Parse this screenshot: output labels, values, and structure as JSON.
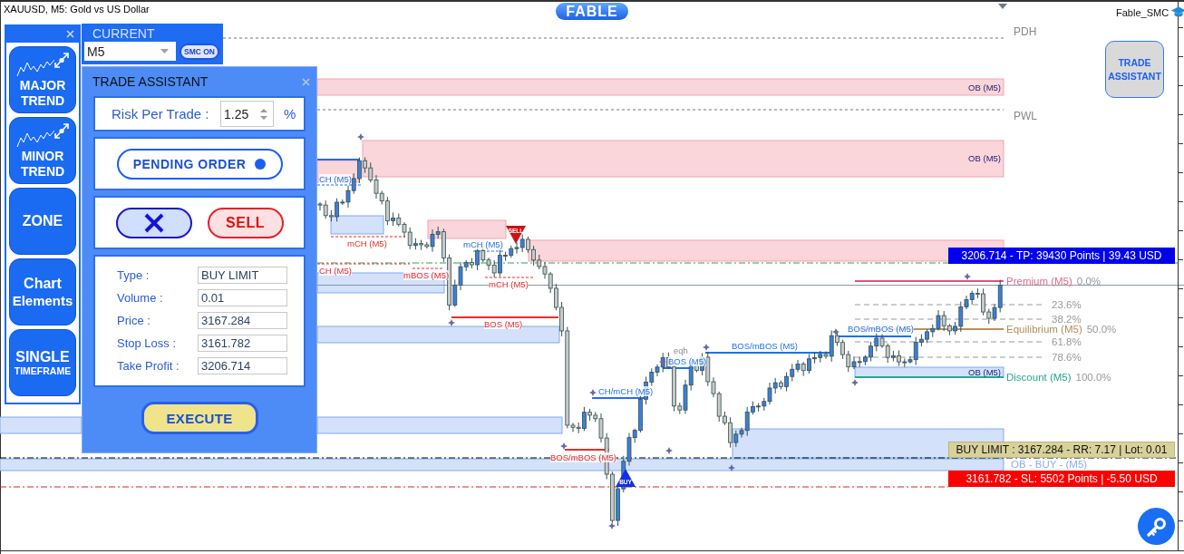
{
  "window": {
    "title": "XAUUSD, M5: Gold vs US Dollar",
    "logo": "FABLE",
    "indicator": "Fable_SMC"
  },
  "toolbar": {
    "items": [
      {
        "label": "MAJOR TREND",
        "kind": "trend"
      },
      {
        "label": "MINOR TREND",
        "kind": "trend"
      },
      {
        "label": "ZONE",
        "kind": "plain"
      },
      {
        "label": "Chart Elements",
        "kind": "plain"
      },
      {
        "label": "SINGLE TIMEFRAME",
        "kind": "plain"
      }
    ]
  },
  "timeframe_panel": {
    "title": "CURRENT",
    "timeframe": "M5",
    "smc_button": "SMC ON"
  },
  "trade_assistant": {
    "title": "TRADE ASSISTANT",
    "risk_label": "Risk Per Trade :",
    "risk_value": "1.25",
    "risk_unit": "%",
    "pending_button": "PENDING ORDER",
    "sell_button": "SELL",
    "fields": [
      {
        "label": "Type :",
        "value": "BUY LIMIT"
      },
      {
        "label": "Volume :",
        "value": "0.01"
      },
      {
        "label": "Price :",
        "value": "3167.284"
      },
      {
        "label": "Stop Loss :",
        "value": "3161.782"
      },
      {
        "label": "Take Profit :",
        "value": "3206.714"
      }
    ],
    "execute_button": "EXECUTE"
  },
  "trade_assistant_button": "TRADE ASSISTANT",
  "chart": {
    "levels": [
      {
        "label": "PDH"
      },
      {
        "label": "PWL"
      }
    ],
    "zones": [
      {
        "label": "OB (M5)",
        "kind": "supply"
      },
      {
        "label": "OB (M5)",
        "kind": "supply"
      },
      {
        "label": "OB (M5)",
        "kind": "demand"
      },
      {
        "label": "OB - BUY - (M5)",
        "kind": "buy_order"
      }
    ],
    "structure": [
      {
        "label": "CH (M5)",
        "kind": "bullish"
      },
      {
        "label": "mCH (M5)",
        "kind": "bearish"
      },
      {
        "label": "CH (M5)",
        "kind": "bearish"
      },
      {
        "label": "mBOS (M5)",
        "kind": "bearish"
      },
      {
        "label": "mCH (M5)",
        "kind": "bullish"
      },
      {
        "label": "mCH (M5)",
        "kind": "bearish"
      },
      {
        "label": "BOS (M5)",
        "kind": "bearish"
      },
      {
        "label": "BOS/mBOS (M5)",
        "kind": "bearish"
      },
      {
        "label": "CH/mCH (M5)",
        "kind": "bullish"
      },
      {
        "label": "BOS (M5)",
        "kind": "bullish"
      },
      {
        "label": "eqh",
        "kind": "equal"
      },
      {
        "label": "BOS/mBOS (M5)",
        "kind": "bullish"
      },
      {
        "label": "BOS/mBOS (M5)",
        "kind": "bullish"
      }
    ],
    "fibonacci": [
      {
        "zone": "Premium (M5)",
        "percent": "0.0%",
        "kind": "premium"
      },
      {
        "percent": "23.6%",
        "kind": "level"
      },
      {
        "percent": "38.2%",
        "kind": "level"
      },
      {
        "zone": "Equilibrium (M5)",
        "percent": "50.0%",
        "kind": "equilibrium"
      },
      {
        "percent": "61.8%",
        "kind": "level"
      },
      {
        "percent": "78.6%",
        "kind": "level"
      },
      {
        "zone": "Discount (M5)",
        "percent": "100.0%",
        "kind": "discount"
      }
    ],
    "order_lines": [
      {
        "label": "3206.714 - TP: 39430 Points | 39.43 USD",
        "kind": "take_profit"
      },
      {
        "label": "BUY LIMIT : 3167.284 - RR: 7.17 | Lot: 0.01",
        "kind": "entry"
      },
      {
        "label": "3161.782 - SL: 5502 Points | -5.50 USD",
        "kind": "stop_loss"
      }
    ],
    "signals": [
      {
        "label": "SELL",
        "kind": "sell"
      },
      {
        "label": "BUY",
        "kind": "buy"
      }
    ]
  }
}
